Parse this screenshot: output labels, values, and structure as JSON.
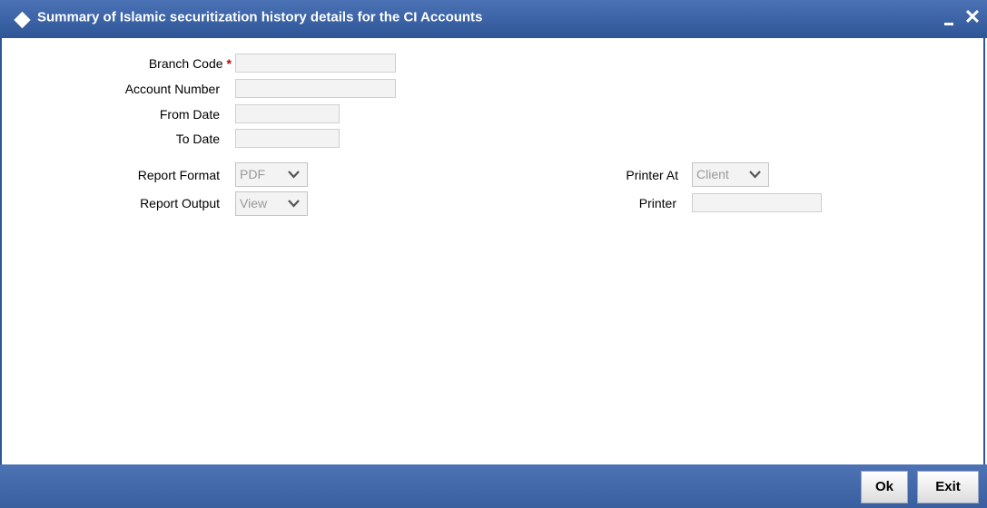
{
  "window": {
    "title": "Summary of Islamic securitization history details for the CI Accounts",
    "minimize_label": "",
    "close_label": "✕"
  },
  "form": {
    "branch_code_label": "Branch Code",
    "branch_code_required": "*",
    "branch_code_value": "",
    "account_number_label": "Account Number",
    "account_number_value": "",
    "from_date_label": "From Date",
    "from_date_value": "",
    "to_date_label": "To Date",
    "to_date_value": "",
    "report_format_label": "Report Format",
    "report_format_value": "PDF",
    "report_output_label": "Report Output",
    "report_output_value": "View",
    "printer_at_label": "Printer At",
    "printer_at_value": "Client",
    "printer_label": "Printer",
    "printer_value": ""
  },
  "footer": {
    "ok_label": "Ok",
    "exit_label": "Exit"
  },
  "colors": {
    "titlebar": "#2e5596",
    "required": "#cc0000",
    "field_bg": "#f3f3f3"
  }
}
